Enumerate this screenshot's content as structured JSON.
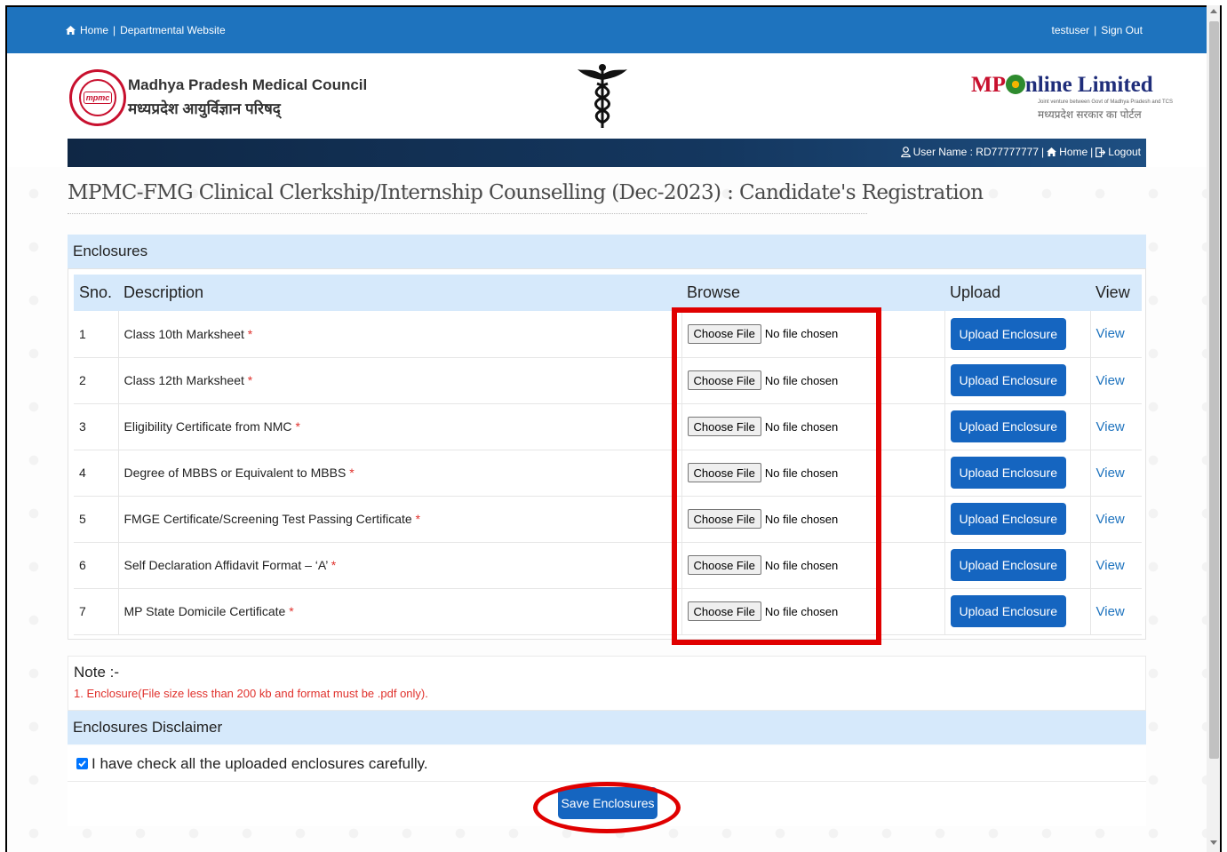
{
  "topbar": {
    "home": "Home",
    "separator": "|",
    "departmental": "Departmental Website",
    "user": "testuser",
    "sign_out": "Sign Out"
  },
  "header": {
    "org_name_en": "Madhya Pradesh Medical Council",
    "org_name_hi": "मध्यप्रदेश आयुर्विज्ञान परिषद्",
    "seal_text": "mpmc",
    "mponline_prefix": "MP",
    "mponline_mid": "nline ",
    "mponline_suffix": "Limited",
    "mponline_sub": "Joint venture between Govt of Madhya Pradesh and TCS",
    "mponline_hi": "मध्यप्रदेश सरकार का पोर्टल"
  },
  "navbar": {
    "user_label": "User Name : RD77777777",
    "sep": "|",
    "home": "Home",
    "logout": "Logout"
  },
  "page_title": "MPMC-FMG Clinical Clerkship/Internship Counselling (Dec-2023) : Candidate's Registration",
  "enclosures": {
    "section_title": "Enclosures",
    "columns": [
      "Sno.",
      "Description",
      "Browse",
      "Upload",
      "View"
    ],
    "choose_label": "Choose File",
    "no_file": "No file chosen",
    "upload_label": "Upload Enclosure",
    "view_label": "View",
    "required_mark": "*",
    "rows": [
      {
        "sno": "1",
        "desc": "Class 10th Marksheet"
      },
      {
        "sno": "2",
        "desc": "Class 12th Marksheet"
      },
      {
        "sno": "3",
        "desc": "Eligibility Certificate from NMC"
      },
      {
        "sno": "4",
        "desc": "Degree of MBBS or Equivalent to MBBS"
      },
      {
        "sno": "5",
        "desc": "FMGE Certificate/Screening Test Passing Certificate"
      },
      {
        "sno": "6",
        "desc": "Self Declaration Affidavit Format – ‘A’"
      },
      {
        "sno": "7",
        "desc": "MP State Domicile Certificate"
      }
    ]
  },
  "note": {
    "title": "Note :-",
    "text": "1. Enclosure(File size less than 200 kb and format must be .pdf only)."
  },
  "disclaimer": {
    "title": "Enclosures Disclaimer",
    "check_text": "I have check all the uploaded enclosures carefully.",
    "checked": true
  },
  "save_label": "Save Enclosures",
  "colors": {
    "topbar": "#1e73be",
    "section_bg": "#d6e9fb",
    "button": "#1565c0",
    "highlight": "#e00000",
    "required": "#e0312c"
  }
}
